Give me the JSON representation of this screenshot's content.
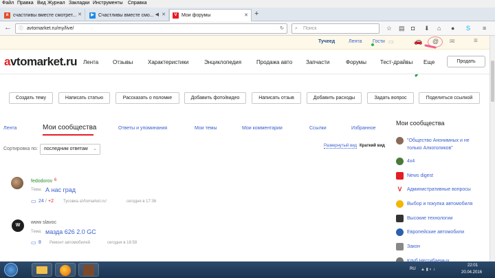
{
  "menubar": [
    "Файл",
    "Правка",
    "Вид",
    "Журнал",
    "Закладки",
    "Инструменты",
    "Справка"
  ],
  "tabs": [
    {
      "label": "счастливы вместе смотрет...",
      "favicon": "#e34c26",
      "active": false
    },
    {
      "label": "Счастливы вместе смо...",
      "favicon": "#1e88e5",
      "active": false
    },
    {
      "label": "Мои форумы",
      "favicon": "#e31e24",
      "active": true
    }
  ],
  "new_tab": "+",
  "url": "avtomarket.ru/my/live/",
  "search_placeholder": "Поиск",
  "userbar": {
    "username": "Тучеед",
    "tape": "Лента",
    "guests": "Гости"
  },
  "logo": {
    "a": "a",
    "rest": "vtomarket.ru"
  },
  "mainnav": [
    "Лента",
    "Отзывы",
    "Характеристики",
    "Энциклопедия",
    "Продажа авто",
    "Запчасти",
    "Форумы",
    "Тест-драйвы",
    "Еще"
  ],
  "sell_button": "Продать",
  "actions": [
    "Создать тему",
    "Написать статью",
    "Рассказать о поломке",
    "Добавить фото/видео",
    "Написать отзыв",
    "Добавить расходы",
    "Задать вопрос",
    "Поделиться ссылкой"
  ],
  "filter_tabs": [
    "Лента",
    "Мои сообщества",
    "Ответы и упоминания",
    "Мои темы",
    "Мои комментарии",
    "Ссылки",
    "Избранное"
  ],
  "sort": {
    "label": "Сортировка по:",
    "value": "последним ответам",
    "view_expanded": "Развернутый вид",
    "view_short": "Краткий вид"
  },
  "posts": [
    {
      "author": "fedodorov",
      "badge": "6",
      "topic_label": "Тема:",
      "topic": "А нас град",
      "replies": "24",
      "new": "+2",
      "forum": "Тусовка aVtomarket.ru!",
      "time": "сегодня в 17:36"
    },
    {
      "author": "www slavoc",
      "topic_label": "Тема:",
      "topic": "мазда 626 2.0 GC",
      "replies": "8",
      "forum": "Ремонт автомобилей",
      "time": "сегодня в 18:58"
    }
  ],
  "sidebar": {
    "title": "Мои сообщества",
    "items": [
      {
        "label": "\"Общество Анонимных и не только Алкоголиков\"",
        "color": "#8a6a5a"
      },
      {
        "label": "4x4",
        "color": "#4a7a3a"
      },
      {
        "label": "News digest",
        "color": "#e31e24"
      },
      {
        "label": "Административные вопросы",
        "color": "#e31e24"
      },
      {
        "label": "Выбор и покупка автомобиля",
        "color": "#f2b705"
      },
      {
        "label": "Высокие технологии",
        "color": "#333333"
      },
      {
        "label": "Европейские автомобили",
        "color": "#2d5fb0"
      },
      {
        "label": "Закон",
        "color": "#888888"
      },
      {
        "label": "Клуб Несгибаемых",
        "color": "#777777"
      }
    ]
  },
  "taskbar": {
    "lang": "RU",
    "time": "22:01",
    "date": "20.04.2016"
  }
}
